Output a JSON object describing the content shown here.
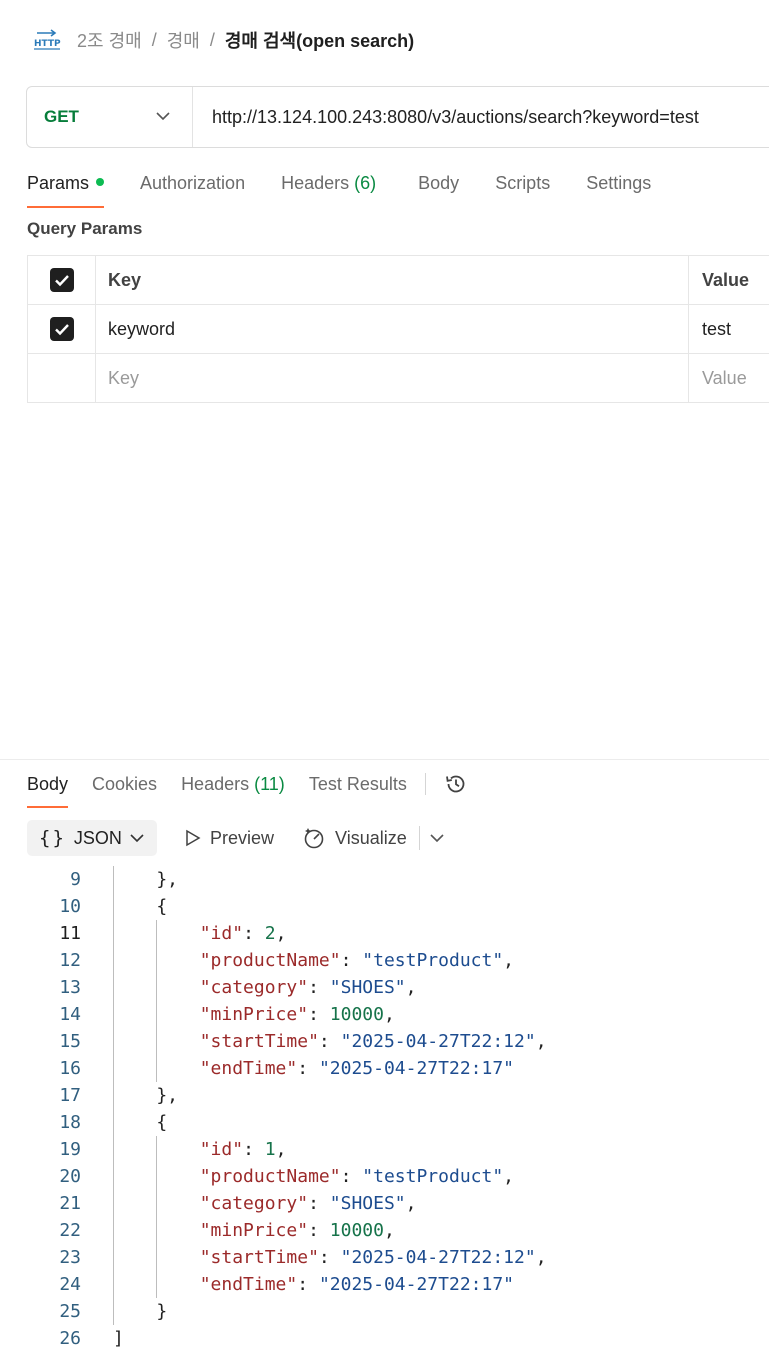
{
  "breadcrumb": {
    "items": [
      "2조 경매",
      "경매"
    ],
    "separator": "/",
    "current": "경매 검색(open search)"
  },
  "request": {
    "method": "GET",
    "url": "http://13.124.100.243:8080/v3/auctions/search?keyword=test"
  },
  "request_tabs": {
    "params": "Params",
    "authorization": "Authorization",
    "headers": "Headers",
    "headers_count": "(6)",
    "body": "Body",
    "scripts": "Scripts",
    "settings": "Settings"
  },
  "query_params": {
    "title": "Query Params",
    "header_key": "Key",
    "header_value": "Value",
    "rows": [
      {
        "key": "keyword",
        "value": "test",
        "checked": true
      }
    ],
    "placeholder_key": "Key",
    "placeholder_value": "Value"
  },
  "response_tabs": {
    "body": "Body",
    "cookies": "Cookies",
    "headers": "Headers",
    "headers_count": "(11)",
    "test_results": "Test Results"
  },
  "view": {
    "format": "JSON",
    "preview": "Preview",
    "visualize": "Visualize"
  },
  "code_lines": [
    {
      "n": "9",
      "text": "},"
    },
    {
      "n": "10",
      "text": "{"
    },
    {
      "n": "11",
      "key": "\"id\"",
      "value": "2",
      "kind": "n",
      "comma": true
    },
    {
      "n": "12",
      "key": "\"productName\"",
      "value": "\"testProduct\"",
      "kind": "s",
      "comma": true
    },
    {
      "n": "13",
      "key": "\"category\"",
      "value": "\"SHOES\"",
      "kind": "s",
      "comma": true
    },
    {
      "n": "14",
      "key": "\"minPrice\"",
      "value": "10000",
      "kind": "n",
      "comma": true
    },
    {
      "n": "15",
      "key": "\"startTime\"",
      "value": "\"2025-04-27T22:12\"",
      "kind": "s",
      "comma": true
    },
    {
      "n": "16",
      "key": "\"endTime\"",
      "value": "\"2025-04-27T22:17\"",
      "kind": "s",
      "comma": false
    },
    {
      "n": "17",
      "text": "},"
    },
    {
      "n": "18",
      "text": "{"
    },
    {
      "n": "19",
      "key": "\"id\"",
      "value": "1",
      "kind": "n",
      "comma": true
    },
    {
      "n": "20",
      "key": "\"productName\"",
      "value": "\"testProduct\"",
      "kind": "s",
      "comma": true
    },
    {
      "n": "21",
      "key": "\"category\"",
      "value": "\"SHOES\"",
      "kind": "s",
      "comma": true
    },
    {
      "n": "22",
      "key": "\"minPrice\"",
      "value": "10000",
      "kind": "n",
      "comma": true
    },
    {
      "n": "23",
      "key": "\"startTime\"",
      "value": "\"2025-04-27T22:12\"",
      "kind": "s",
      "comma": true
    },
    {
      "n": "24",
      "key": "\"endTime\"",
      "value": "\"2025-04-27T22:17\"",
      "kind": "s",
      "comma": false
    },
    {
      "n": "25",
      "text": "}"
    },
    {
      "n": "26",
      "text": "]"
    }
  ],
  "active_line": "11",
  "colors": {
    "accent": "#ff6c37",
    "method": "#077d3a",
    "dot": "#0cbb52",
    "key": "#9b2a2a",
    "string": "#1d4c8f",
    "number": "#16734a"
  }
}
